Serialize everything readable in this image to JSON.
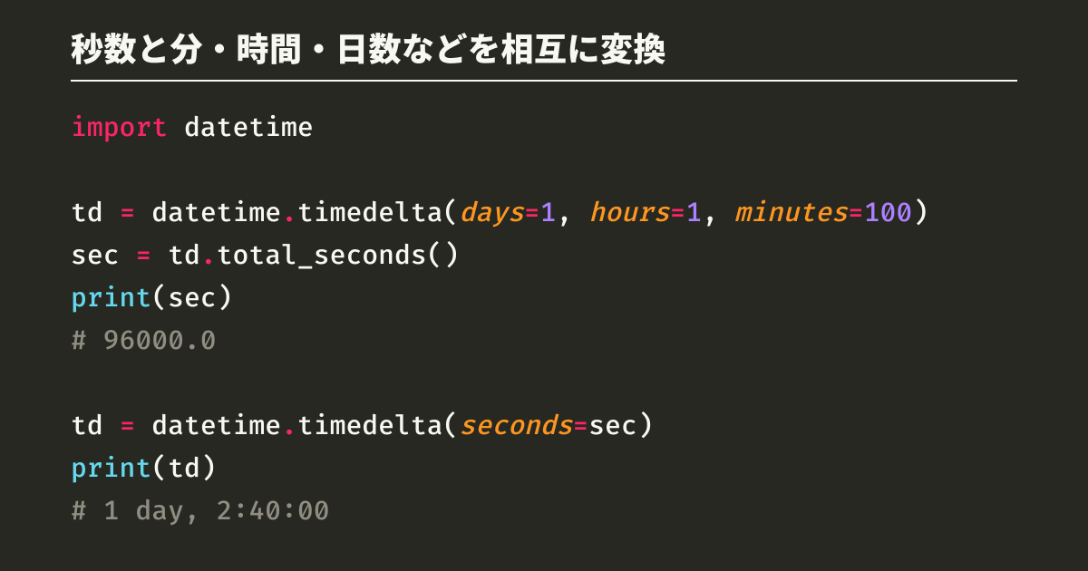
{
  "title": "秒数と分・時間・日数などを相互に変換",
  "code": {
    "t": {
      "import": "import",
      "datetime": "datetime",
      "td": "td",
      "eq": "=",
      "dot": ".",
      "timedelta": "timedelta",
      "lparen": "(",
      "rparen": ")",
      "comma": ",",
      "days": "days",
      "hours": "hours",
      "minutes": "minutes",
      "seconds_kw": "seconds",
      "one": "1",
      "hundred": "100",
      "sec": "sec",
      "total_seconds": "total_seconds",
      "print": "print",
      "cmt1": "# 96000.0",
      "cmt2": "# 1 day, 2:40:00"
    }
  }
}
